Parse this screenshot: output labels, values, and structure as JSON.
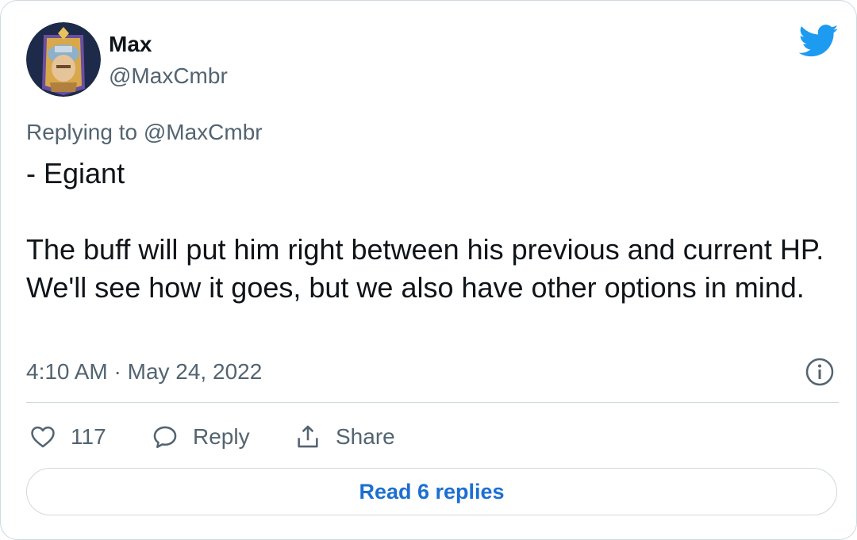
{
  "author": {
    "display_name": "Max",
    "handle": "@MaxCmbr"
  },
  "icons": {
    "brand": "twitter-bird-icon",
    "info": "info-icon",
    "like": "heart-icon",
    "reply": "speech-bubble-icon",
    "share": "share-upload-icon"
  },
  "tweet": {
    "replying_to": "Replying to @MaxCmbr",
    "text": "- Egiant\n\nThe buff will put him right between his previous and current HP. We'll see how it goes, but we also have other options in mind.",
    "timestamp": "4:10 AM · May 24, 2022"
  },
  "actions": {
    "like_count": "117",
    "reply_label": "Reply",
    "share_label": "Share"
  },
  "read_replies_label": "Read 6 replies",
  "colors": {
    "twitter_blue": "#1d9bf0",
    "link_blue": "#1d6fd1",
    "text_primary": "#0f1419",
    "text_secondary": "#536471",
    "border": "#cfd9de"
  }
}
